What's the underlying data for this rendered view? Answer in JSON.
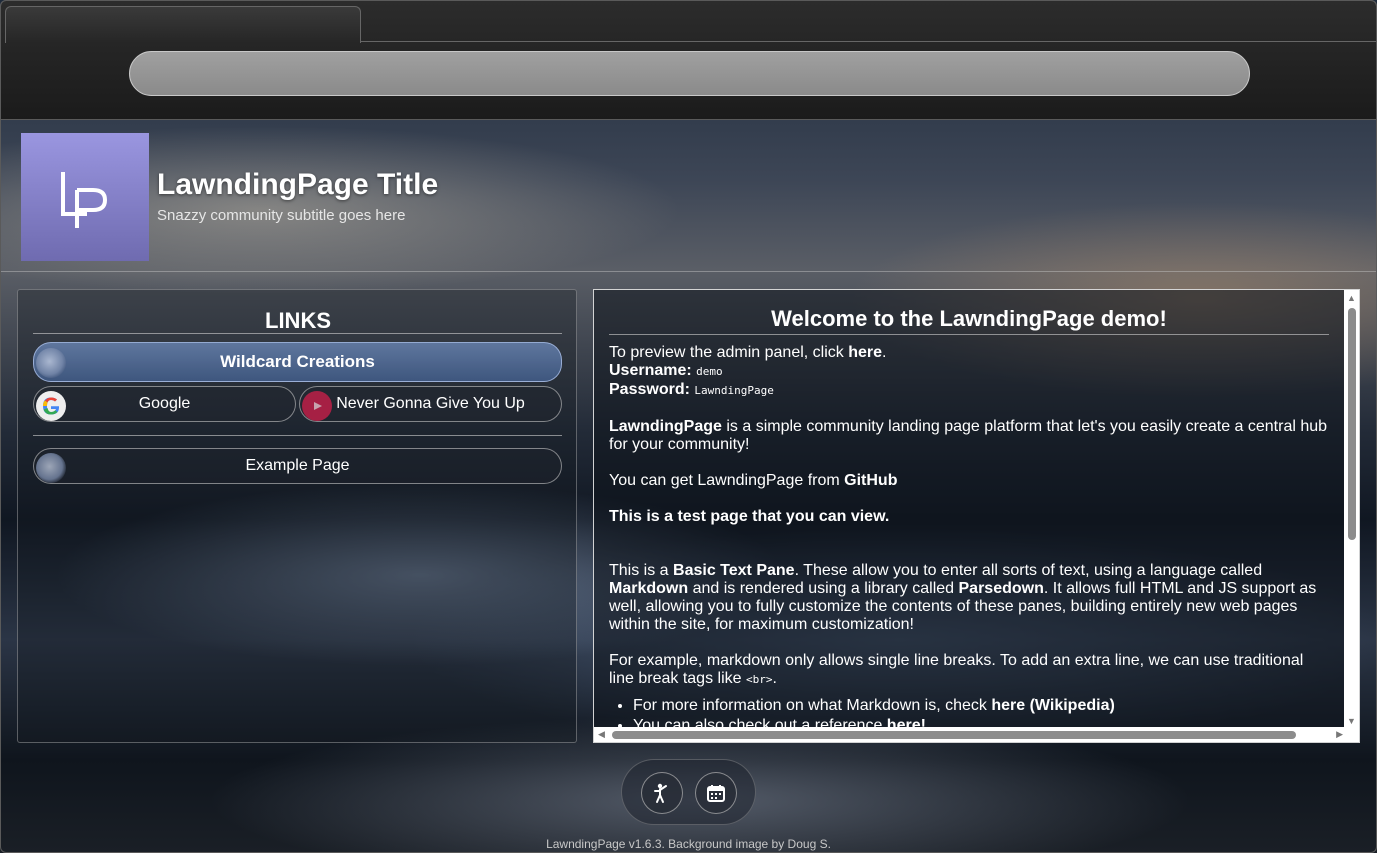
{
  "browser": {
    "tab_title": "",
    "address": ""
  },
  "header": {
    "logo_text": "LP",
    "title": "LawndingPage Title",
    "subtitle": "Snazzy community subtitle goes here"
  },
  "links": {
    "title": "LINKS",
    "primary": "Wildcard Creations",
    "row": [
      {
        "label": "Google",
        "icon": "google-icon"
      },
      {
        "label": "Never Gonna Give You Up",
        "icon": "youtube-icon"
      }
    ],
    "page": "Example Page"
  },
  "content": {
    "title": "Welcome to the LawndingPage demo!",
    "preview_prefix": "To preview the admin panel, click ",
    "preview_link": "here",
    "preview_suffix": ".",
    "username_label": "Username:",
    "username_value": "demo",
    "password_label": "Password:",
    "password_value": "LawndingPage",
    "intro_bold": "LawndingPage",
    "intro_rest": " is a simple community landing page platform that let's you easily create a central hub for your community!",
    "get_prefix": "You can get LawndingPage from ",
    "get_link": "GitHub",
    "test_page": "This is a test page that you can view.",
    "p1_a": "This is a ",
    "p1_b": "Basic Text Pane",
    "p1_c": ". These allow you to enter all sorts of text, using a language called ",
    "p1_d": "Markdown",
    "p1_e": " and is rendered using a library called ",
    "p1_f": "Parsedown",
    "p1_g": ". It allows full HTML and JS support as well, allowing you to fully customize the contents of these panes, building entirely new web pages within the site, for maximum customization!",
    "p2_a": "For example, markdown only allows single line breaks. To add an extra line, we can use traditional line break tags like ",
    "p2_code": "<br>",
    "p2_b": ".",
    "bullet1_a": "For more information on what Markdown is, check ",
    "bullet1_link": "here (Wikipedia)",
    "bullet2_a": "You can also check out a reference ",
    "bullet2_link": "here!"
  },
  "dock": {
    "btn1_icon": "accessibility-person-icon",
    "btn2_icon": "calendar-icon"
  },
  "footer": {
    "text": "LawndingPage v1.6.3. Background image by Doug S."
  },
  "colors": {
    "logo_top": "#9a96e0",
    "logo_bottom": "#6f6bb0",
    "primary_link": "#5a7ab0"
  }
}
